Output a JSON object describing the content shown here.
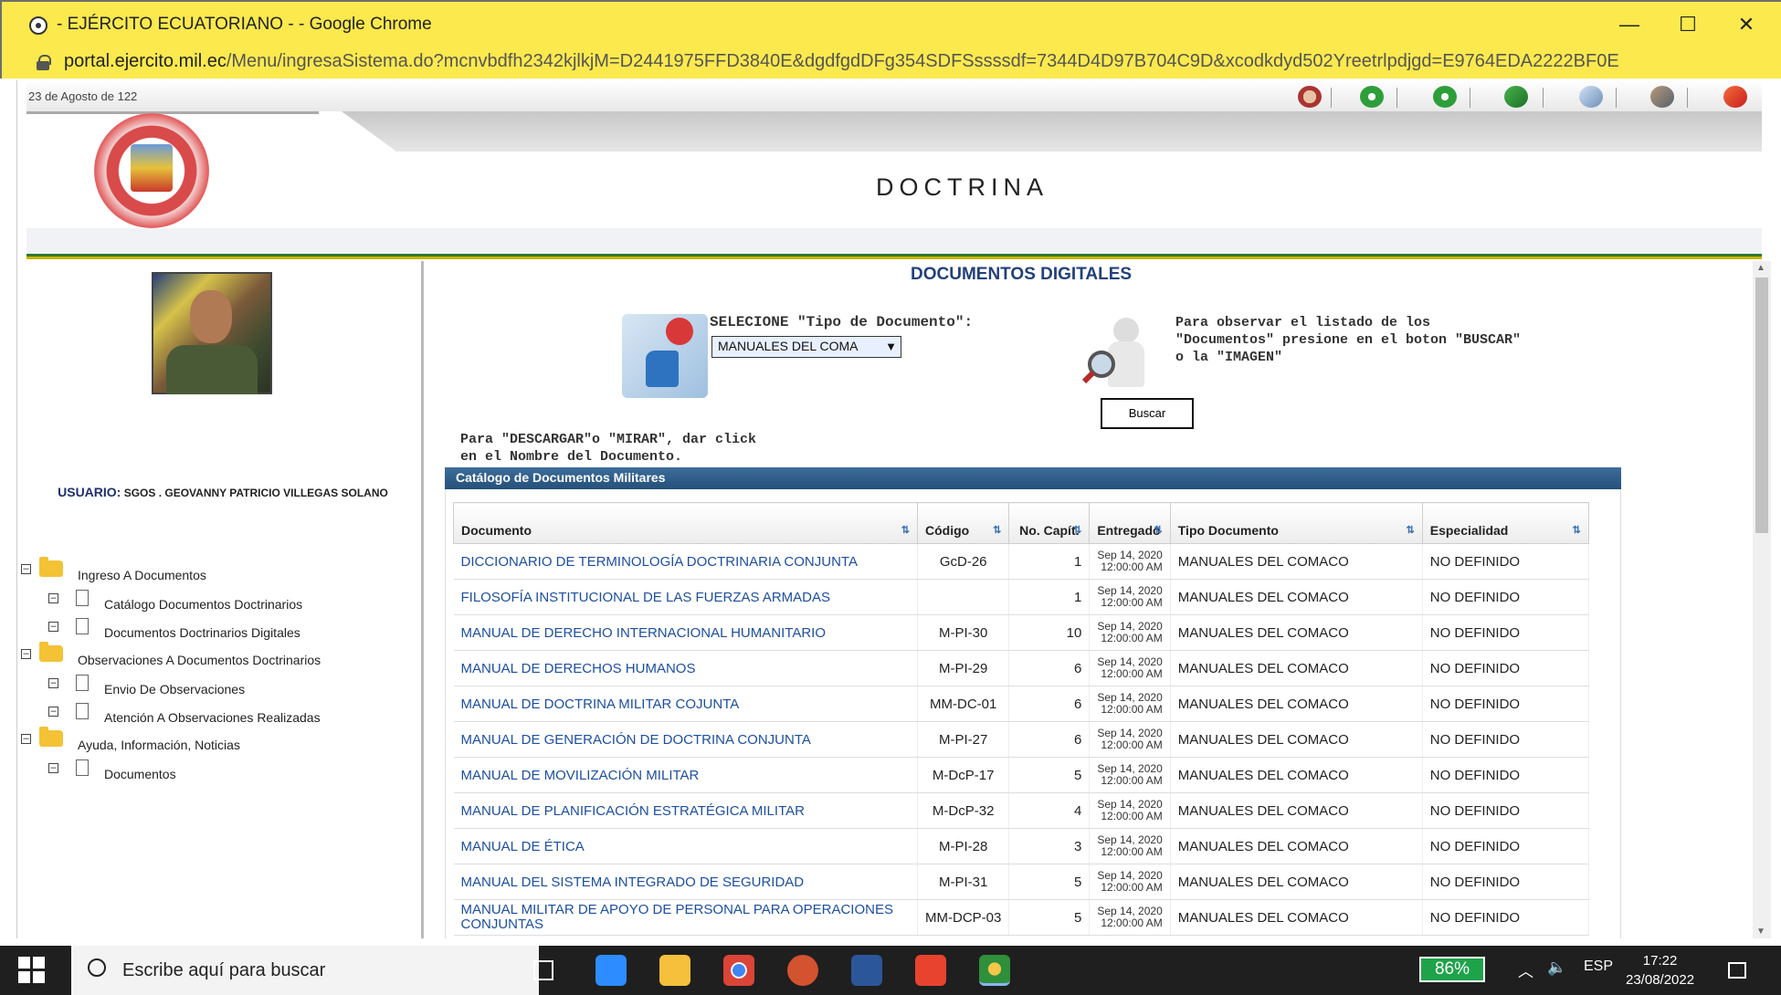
{
  "window": {
    "title": "- EJÉRCITO ECUATORIANO - - Google Chrome",
    "url_domain": "portal.ejercito.mil.ec",
    "url_path": "/Menu/ingresaSistema.do?mcnvbdfh2342kjlkjM=D2441975FFD3840E&dgdfgdDFg354SDFSssssdf=7344D4D97B704C9D&xcodkdyd502Yreetrlpdjgd=E9764EDA2222BF0E",
    "min": "—",
    "max": "☐",
    "close": "✕"
  },
  "page": {
    "date": "23 de Agosto de 122",
    "title": "DOCTRINA",
    "section_title": "DOCUMENTOS DIGITALES"
  },
  "toolbar_icons": [
    "home-icon",
    "back-icon",
    "forward-icon",
    "refresh-icon",
    "print-icon",
    "user-settings-icon",
    "exit-icon"
  ],
  "user": {
    "label": "USUARIO:",
    "name": "SGOS . GEOVANNY PATRICIO VILLEGAS SOLANO"
  },
  "tree": [
    {
      "label": "Ingreso A Documentos",
      "type": "folder"
    },
    {
      "label": "Catálogo Documentos Doctrinarios",
      "type": "page"
    },
    {
      "label": "Documentos Doctrinarios Digitales",
      "type": "page"
    },
    {
      "label": "Observaciones A Documentos Doctrinarios",
      "type": "folder"
    },
    {
      "label": "Envio De Observaciones",
      "type": "page"
    },
    {
      "label": "Atención A Observaciones Realizadas",
      "type": "page"
    },
    {
      "label": "Ayuda, Información, Noticias",
      "type": "folder"
    },
    {
      "label": "Documentos",
      "type": "page"
    }
  ],
  "selector": {
    "label": "SELECIONE \"Tipo de Documento\":",
    "value": "MANUALES DEL COMA"
  },
  "instructions": {
    "search": "Para observar el listado de los \"Documentos\" presione en el boton \"BUSCAR\" o la \"IMAGEN\"",
    "download": "Para \"DESCARGAR\"o \"MIRAR\", dar click en el Nombre del Documento.",
    "buscar": "Buscar"
  },
  "catalog": {
    "title": "Catálogo de Documentos Militares",
    "columns": {
      "doc": "Documento",
      "cod": "Código",
      "cap": "No. Capít.",
      "ent": "Entregado",
      "tipo": "Tipo Documento",
      "esp": "Especialidad"
    },
    "rows": [
      {
        "doc": "DICCIONARIO DE TERMINOLOGÍA DOCTRINARIA CONJUNTA",
        "cod": "GcD-26",
        "cap": "1",
        "d1": "Sep 14, 2020",
        "d2": "12:00:00 AM",
        "tipo": "MANUALES DEL COMACO",
        "esp": "NO DEFINIDO"
      },
      {
        "doc": "FILOSOFÍA INSTITUCIONAL DE LAS FUERZAS ARMADAS",
        "cod": "",
        "cap": "1",
        "d1": "Sep 14, 2020",
        "d2": "12:00:00 AM",
        "tipo": "MANUALES DEL COMACO",
        "esp": "NO DEFINIDO"
      },
      {
        "doc": "MANUAL DE DERECHO INTERNACIONAL HUMANITARIO",
        "cod": "M-PI-30",
        "cap": "10",
        "d1": "Sep 14, 2020",
        "d2": "12:00:00 AM",
        "tipo": "MANUALES DEL COMACO",
        "esp": "NO DEFINIDO"
      },
      {
        "doc": "MANUAL DE DERECHOS HUMANOS",
        "cod": "M-PI-29",
        "cap": "6",
        "d1": "Sep 14, 2020",
        "d2": "12:00:00 AM",
        "tipo": "MANUALES DEL COMACO",
        "esp": "NO DEFINIDO"
      },
      {
        "doc": "MANUAL DE DOCTRINA MILITAR COJUNTA",
        "cod": "MM-DC-01",
        "cap": "6",
        "d1": "Sep 14, 2020",
        "d2": "12:00:00 AM",
        "tipo": "MANUALES DEL COMACO",
        "esp": "NO DEFINIDO"
      },
      {
        "doc": "MANUAL DE GENERACIÓN DE DOCTRINA CONJUNTA",
        "cod": "M-PI-27",
        "cap": "6",
        "d1": "Sep 14, 2020",
        "d2": "12:00:00 AM",
        "tipo": "MANUALES DEL COMACO",
        "esp": "NO DEFINIDO"
      },
      {
        "doc": "MANUAL DE MOVILIZACIÓN MILITAR",
        "cod": "M-DcP-17",
        "cap": "5",
        "d1": "Sep 14, 2020",
        "d2": "12:00:00 AM",
        "tipo": "MANUALES DEL COMACO",
        "esp": "NO DEFINIDO"
      },
      {
        "doc": "MANUAL DE PLANIFICACIÓN ESTRATÉGICA MILITAR",
        "cod": "M-DcP-32",
        "cap": "4",
        "d1": "Sep 14, 2020",
        "d2": "12:00:00 AM",
        "tipo": "MANUALES DEL COMACO",
        "esp": "NO DEFINIDO"
      },
      {
        "doc": "MANUAL DE ÉTICA",
        "cod": "M-PI-28",
        "cap": "3",
        "d1": "Sep 14, 2020",
        "d2": "12:00:00 AM",
        "tipo": "MANUALES DEL COMACO",
        "esp": "NO DEFINIDO"
      },
      {
        "doc": "MANUAL DEL SISTEMA INTEGRADO DE SEGURIDAD",
        "cod": "M-PI-31",
        "cap": "5",
        "d1": "Sep 14, 2020",
        "d2": "12:00:00 AM",
        "tipo": "MANUALES DEL COMACO",
        "esp": "NO DEFINIDO"
      },
      {
        "doc": "MANUAL MILITAR DE APOYO DE PERSONAL PARA OPERACIONES CONJUNTAS",
        "cod": "MM-DCP-03",
        "cap": "5",
        "d1": "Sep 14, 2020",
        "d2": "12:00:00 AM",
        "tipo": "MANUALES DEL COMACO",
        "esp": "NO DEFINIDO"
      }
    ]
  },
  "taskbar": {
    "search_placeholder": "Escribe aquí para buscar",
    "battery": "86%",
    "lang": "ESP",
    "time": "17:22",
    "date": "23/08/2022"
  }
}
